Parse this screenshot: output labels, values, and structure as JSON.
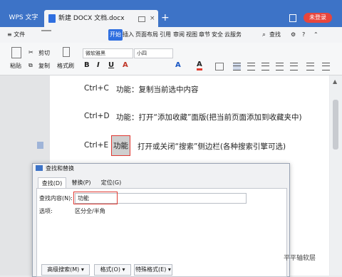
{
  "titlebar": {
    "app_tab": "WPS 文字",
    "doc_tab": "新建 DOCX 文档.docx",
    "close_glyph": "×",
    "new_tab_glyph": "+",
    "login_label": "未登录",
    "accent": "#3d73c7"
  },
  "menubar": {
    "file_label": "≡ 文件",
    "items": [
      "开始",
      "插入",
      "页面布局",
      "引用",
      "审阅",
      "视图",
      "章节",
      "安全",
      "云服务"
    ],
    "active_item": "开始",
    "search_label": "查找"
  },
  "ribbon": {
    "cut": "剪切",
    "copy": "复制",
    "format_painter": "格式刷",
    "paste": "粘贴",
    "font_name": "微软雅黑",
    "font_size": "小四",
    "bold": "B",
    "italic": "I",
    "underline": "U",
    "font_a": "A"
  },
  "document": {
    "lines": [
      {
        "key": "Ctrl+C",
        "text": "功能：复制当前选中内容"
      },
      {
        "key": "Ctrl+D",
        "text": "功能：打开“添加收藏”面版(把当前页面添加到收藏夹中)"
      },
      {
        "key": "Ctrl+E",
        "highlight": "功能",
        "text": "打开或关闭“搜索”侧边栏(各种搜索引擎可选)"
      }
    ]
  },
  "dialog": {
    "title": "查找和替换",
    "tabs": [
      "查找(D)",
      "替换(P)",
      "定位(G)"
    ],
    "active_tab": "查找(D)",
    "find_label": "查找内容(N):",
    "find_value": "功能",
    "options_label": "选项:",
    "options_value": "区分全/半角",
    "buttons": [
      "高级搜索(M) ▾",
      "格式(O) ▾",
      "特殊格式(E) ▾"
    ]
  },
  "watermark": "平平轴软层"
}
